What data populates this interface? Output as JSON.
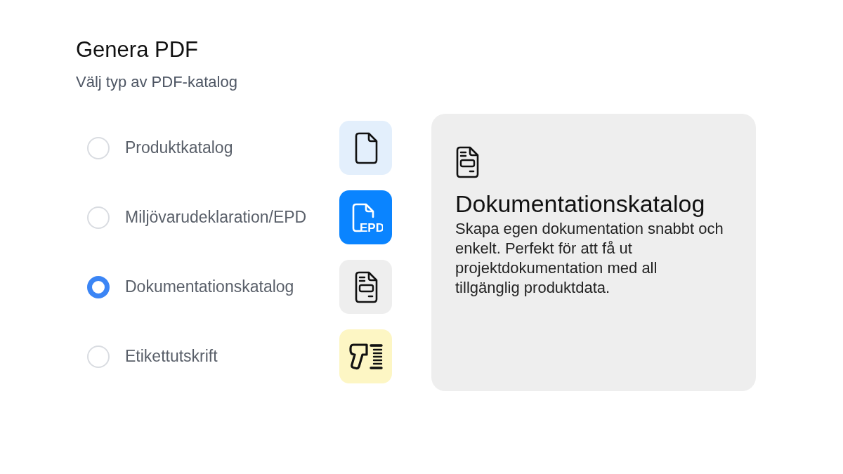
{
  "title": "Genera PDF",
  "subtitle": "Välj typ av PDF-katalog",
  "options": [
    {
      "label": "Produktkatalog",
      "selected": false,
      "kind": "document",
      "color": "#e3effc"
    },
    {
      "label": "Miljövarudeklaration/EPD",
      "selected": false,
      "kind": "epd",
      "color": "#0a84ff",
      "icon_text": "EPD"
    },
    {
      "label": "Dokumentationskatalog",
      "selected": true,
      "kind": "form",
      "color": "#eeeeee"
    },
    {
      "label": "Etikettutskrift",
      "selected": false,
      "kind": "scanner",
      "color": "#fdf6c4"
    }
  ],
  "detail": {
    "kind": "form",
    "title": "Dokumentationskatalog",
    "description": "Skapa egen dokumentation snabbt och enkelt. Perfekt för att få ut projektdokumentation med all tillgänglig produktdata."
  }
}
